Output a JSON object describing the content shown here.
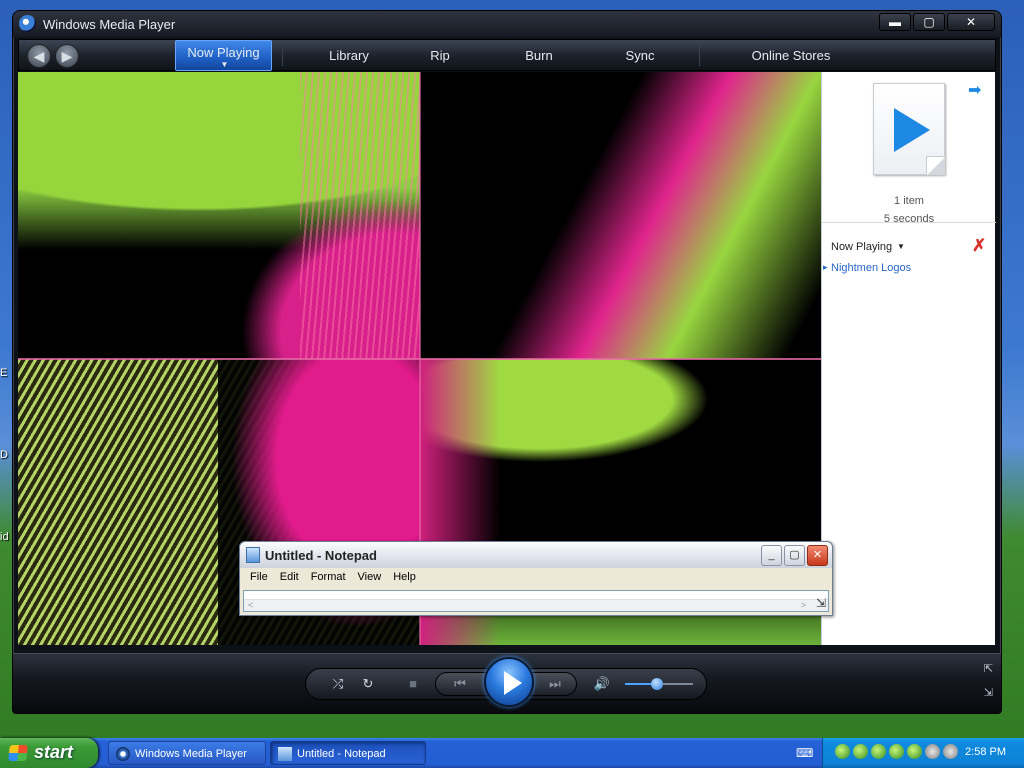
{
  "desktop": {
    "edge_fragments": [
      "E",
      "D",
      "id"
    ]
  },
  "wmp": {
    "title": "Windows Media Player",
    "window_buttons": {
      "minimize": "▬",
      "maximize": "▢",
      "close": "✕"
    },
    "nav": {
      "back": "◀",
      "forward": "▶",
      "tabs": [
        {
          "label": "Now Playing",
          "active": true
        },
        {
          "label": "Library",
          "active": false
        },
        {
          "label": "Rip",
          "active": false
        },
        {
          "label": "Burn",
          "active": false
        },
        {
          "label": "Sync",
          "active": false
        },
        {
          "label": "Online Stores",
          "active": false
        }
      ]
    },
    "pane": {
      "item_count": "1 item",
      "duration": "5 seconds",
      "list_label": "Now Playing",
      "playlist": [
        "Nightmen Logos"
      ]
    },
    "controls": {
      "shuffle": "⤮",
      "repeat": "↻",
      "stop": "■",
      "prev": "⏮",
      "next": "⏭",
      "mute": "🔊",
      "volume": 0.47
    },
    "corner": {
      "full_mode": "⇱",
      "mini_mode": "⇲"
    }
  },
  "notepad": {
    "title": "Untitled - Notepad",
    "menu": [
      "File",
      "Edit",
      "Format",
      "View",
      "Help"
    ],
    "buttons": {
      "minimize": "_",
      "maximize": "▢",
      "close": "✕"
    }
  },
  "taskbar": {
    "start_label": "start",
    "tasks": [
      {
        "label": "Windows Media Player",
        "active": false
      },
      {
        "label": "Untitled - Notepad",
        "active": true
      }
    ],
    "clock": "2:58 PM"
  },
  "colors": {
    "accent": "#1e88e5",
    "playlist_link": "#2867c7",
    "clear_x": "#d9342b"
  }
}
